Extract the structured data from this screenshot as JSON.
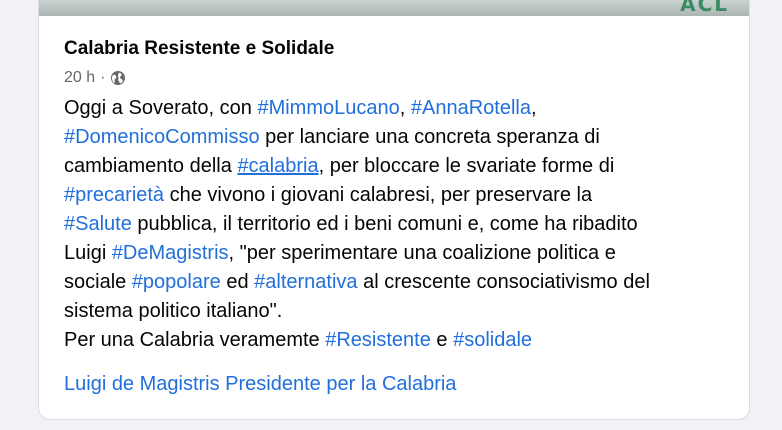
{
  "image_strip": {
    "graffiti_text": "ACL"
  },
  "post": {
    "title": "Calabria Resistente e Solidale",
    "time": "20 h",
    "separator": "·",
    "privacy_icon": "globe-icon",
    "body": {
      "l1_a": "Oggi a Soverato, con ",
      "l1_tag1": "#MimmoLucano",
      "l1_b": ", ",
      "l1_tag2": "#AnnaRotella",
      "l1_c": ",",
      "l2_tag": "#DomenicoCommisso",
      "l2_a": " per lanciare una concreta speranza di",
      "l3_a": "cambiamento della ",
      "l3_tag": "#calabria",
      "l3_b": ", per bloccare le svariate forme di",
      "l4_tag": "#precarietà",
      "l4_a": " che vivono i giovani calabresi, per preservare la",
      "l5_tag": "#Salute",
      "l5_a": " pubblica, il territorio ed i beni comuni e, come ha ribadito",
      "l6_a": "Luigi ",
      "l6_tag": "#DeMagistris",
      "l6_b": ", \"per sperimentare una coalizione politica e",
      "l7_a": "sociale ",
      "l7_tag1": "#popolare",
      "l7_b": " ed ",
      "l7_tag2": "#alternativa",
      "l7_c": " al crescente consociativismo del",
      "l8_a": "sistema politico italiano\".",
      "l9_a": "Per una Calabria veramemte ",
      "l9_tag1": "#Resistente",
      "l9_b": " e ",
      "l9_tag2": "#solidale"
    },
    "page_link": "Luigi de Magistris Presidente per la Calabria"
  },
  "colors": {
    "link": "#216fdb",
    "text": "#050505",
    "meta": "#65676b",
    "background": "#f0f2f5"
  }
}
